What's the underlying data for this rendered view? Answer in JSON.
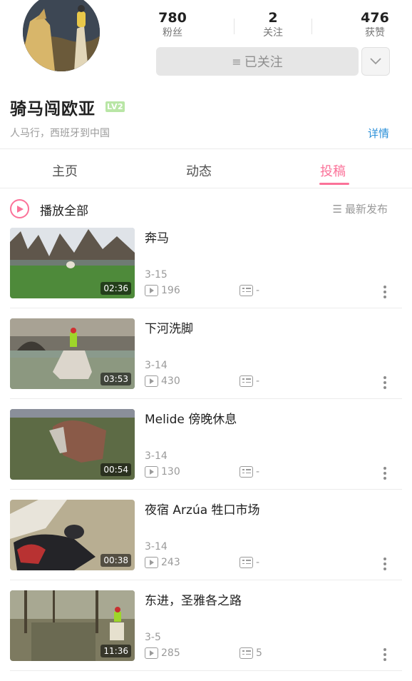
{
  "profile": {
    "stats": [
      {
        "value": "780",
        "label": "粉丝"
      },
      {
        "value": "2",
        "label": "关注"
      },
      {
        "value": "476",
        "label": "获赞"
      }
    ],
    "follow_label": "已关注",
    "name": "骑马闯欧亚",
    "level": "LV2",
    "bio": "人马行，西班牙到中国",
    "detail_link": "详情"
  },
  "tabs": [
    {
      "label": "主页"
    },
    {
      "label": "动态"
    },
    {
      "label": "投稿",
      "active": true
    }
  ],
  "list_header": {
    "play_all": "播放全部",
    "sort": "最新发布"
  },
  "videos": [
    {
      "title": "奔马",
      "duration": "02:36",
      "date": "3-15",
      "plays": "196",
      "danmaku": "-"
    },
    {
      "title": "下河洗脚",
      "duration": "03:53",
      "date": "3-14",
      "plays": "430",
      "danmaku": "-"
    },
    {
      "title": "Melide 傍晚休息",
      "duration": "00:54",
      "date": "3-14",
      "plays": "130",
      "danmaku": "-"
    },
    {
      "title": "夜宿 Arzúa 牲口市场",
      "duration": "00:38",
      "date": "3-14",
      "plays": "243",
      "danmaku": "-"
    },
    {
      "title": "东进，圣雅各之路",
      "duration": "11:36",
      "date": "3-5",
      "plays": "285",
      "danmaku": "5"
    }
  ],
  "colors": {
    "accent": "#fb7299",
    "link": "#2a8fd8",
    "level_badge": "#b9e6a6"
  }
}
